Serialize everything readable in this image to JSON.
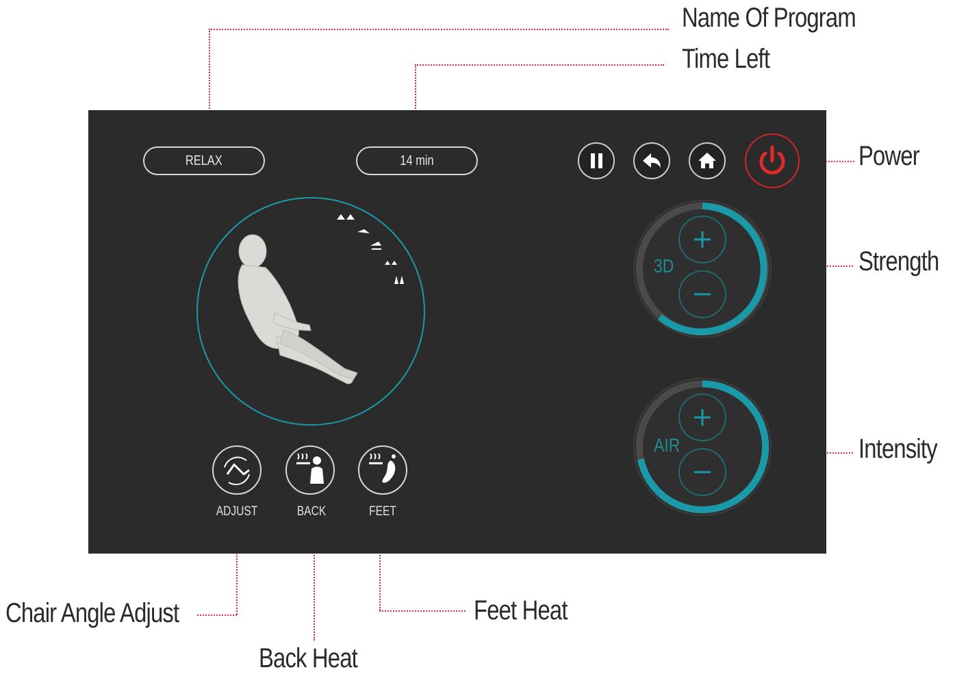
{
  "panel": {
    "program_name": "RELAX",
    "time_left": "14 min",
    "controls": [
      "pause",
      "back",
      "home",
      "power"
    ],
    "strength_dial": {
      "label": "3D",
      "level": 0.62
    },
    "intensity_dial": {
      "label": "AIR",
      "level": 0.78
    },
    "heat_buttons": [
      {
        "label": "ADJUST",
        "icon": "chair-angle-icon"
      },
      {
        "label": "BACK",
        "icon": "back-heat-icon"
      },
      {
        "label": "FEET",
        "icon": "feet-heat-icon"
      }
    ],
    "accent_color": "#1a9aa8",
    "power_color": "#d0262a"
  },
  "callouts": {
    "name_of_program": "Name Of Program",
    "time_left": "Time Left",
    "power": "Power",
    "strength": "Strength",
    "intensity": "Intensity",
    "chair_angle_adjust": "Chair Angle Adjust",
    "back_heat": "Back Heat",
    "feet_heat": "Feet Heat"
  }
}
